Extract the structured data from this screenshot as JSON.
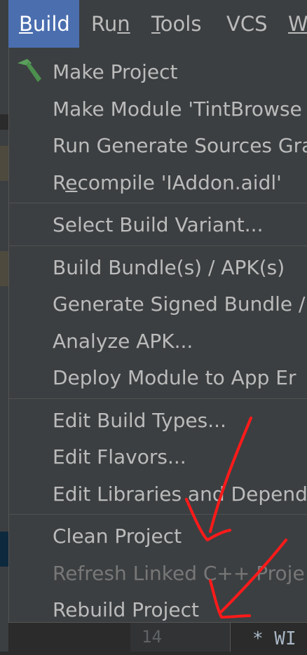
{
  "menubar": {
    "items": [
      "Build",
      "Run",
      "Tools",
      "VCS",
      "W"
    ],
    "mnemonic_index": [
      0,
      2,
      0,
      -1,
      0
    ],
    "active": "Build"
  },
  "build_menu": {
    "groups": [
      [
        {
          "label": "Make Project",
          "icon": "hammer-icon",
          "enabled": true
        },
        {
          "label": "Make Module 'TintBrowse",
          "enabled": true
        },
        {
          "label": "Run Generate Sources Gra",
          "enabled": true
        },
        {
          "label": "Recompile 'IAddon.aidl'",
          "enabled": true,
          "mnemonic": 1
        }
      ],
      [
        {
          "label": "Select Build Variant...",
          "enabled": true
        }
      ],
      [
        {
          "label": "Build Bundle(s) / APK(s)",
          "enabled": true
        },
        {
          "label": "Generate Signed Bundle /",
          "enabled": true
        },
        {
          "label": "Analyze APK...",
          "enabled": true
        },
        {
          "label": "Deploy Module to App Er",
          "enabled": true
        }
      ],
      [
        {
          "label": "Edit Build Types...",
          "enabled": true
        },
        {
          "label": "Edit Flavors...",
          "enabled": true
        },
        {
          "label": "Edit Libraries and Depend",
          "enabled": true
        }
      ],
      [
        {
          "label": "Clean Project",
          "enabled": true
        },
        {
          "label": "Refresh Linked C++ Proje",
          "enabled": false
        },
        {
          "label": "Rebuild Project",
          "enabled": true
        }
      ]
    ]
  },
  "editor": {
    "line_number": "14",
    "code": "* WI"
  },
  "colors": {
    "menu_bg": "#3c3f41",
    "active_menu": "#4b6eaf",
    "text": "#bbbbbb",
    "disabled_text": "#777777",
    "annotation": "#ff1a1a"
  }
}
